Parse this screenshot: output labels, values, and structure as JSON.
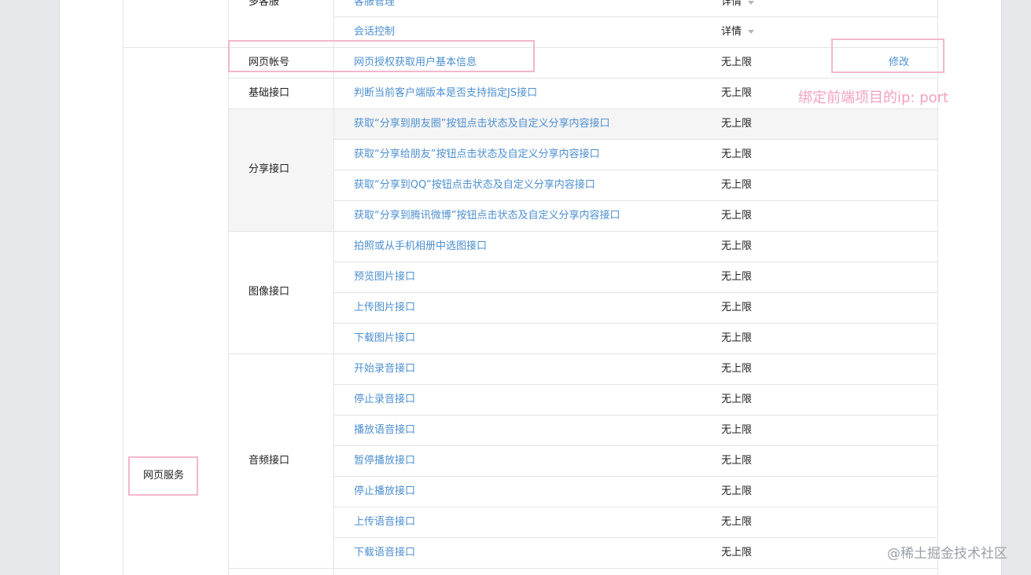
{
  "top_group": {
    "sub_category": "多客服",
    "rows": [
      {
        "api": "客服管理",
        "limit": "详情"
      },
      {
        "api": "会话控制",
        "limit": "详情"
      }
    ]
  },
  "web_service": {
    "category": "网页服务",
    "groups": [
      {
        "sub_category": "网页帐号",
        "rows": [
          {
            "api": "网页授权获取用户基本信息",
            "limit": "无上限",
            "action": "修改"
          }
        ]
      },
      {
        "sub_category": "基础接口",
        "rows": [
          {
            "api": "判断当前客户端版本是否支持指定JS接口",
            "limit": "无上限"
          }
        ]
      },
      {
        "sub_category": "分享接口",
        "rows": [
          {
            "api": "获取“分享到朋友圈”按钮点击状态及自定义分享内容接口",
            "limit": "无上限"
          },
          {
            "api": "获取“分享给朋友”按钮点击状态及自定义分享内容接口",
            "limit": "无上限"
          },
          {
            "api": "获取“分享到QQ”按钮点击状态及自定义分享内容接口",
            "limit": "无上限"
          },
          {
            "api": "获取“分享到腾讯微博”按钮点击状态及自定义分享内容接口",
            "limit": "无上限"
          }
        ]
      },
      {
        "sub_category": "图像接口",
        "rows": [
          {
            "api": "拍照或从手机相册中选图接口",
            "limit": "无上限"
          },
          {
            "api": "预览图片接口",
            "limit": "无上限"
          },
          {
            "api": "上传图片接口",
            "limit": "无上限"
          },
          {
            "api": "下载图片接口",
            "limit": "无上限"
          }
        ]
      },
      {
        "sub_category": "音频接口",
        "rows": [
          {
            "api": "开始录音接口",
            "limit": "无上限"
          },
          {
            "api": "停止录音接口",
            "limit": "无上限"
          },
          {
            "api": "播放语音接口",
            "limit": "无上限"
          },
          {
            "api": "暂停播放接口",
            "limit": "无上限"
          },
          {
            "api": "停止播放接口",
            "limit": "无上限"
          },
          {
            "api": "上传语音接口",
            "limit": "无上限"
          },
          {
            "api": "下载语音接口",
            "limit": "无上限"
          }
        ]
      }
    ]
  },
  "annotation": {
    "text": "绑定前端项目的ip: port"
  },
  "watermark": "@稀土掘金技术社区",
  "colors": {
    "link": "#4d8fd0",
    "highlight": "#f3b6cd",
    "annotation_text": "#f3a0c1"
  }
}
